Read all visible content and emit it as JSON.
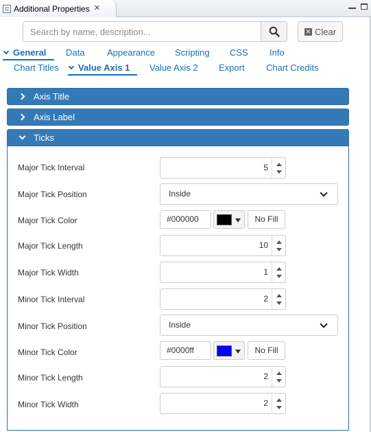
{
  "view": {
    "title": "Additional Properties",
    "close_glyph": "✕"
  },
  "search": {
    "placeholder": "Search by name, description...",
    "value": "",
    "clear_label": "Clear"
  },
  "tabs_primary": [
    {
      "label": "General",
      "active": true
    },
    {
      "label": "Data",
      "active": false
    },
    {
      "label": "Appearance",
      "active": false
    },
    {
      "label": "Scripting",
      "active": false
    },
    {
      "label": "CSS",
      "active": false
    },
    {
      "label": "Info",
      "active": false
    }
  ],
  "tabs_secondary": [
    {
      "label": "Chart Titles",
      "active": false
    },
    {
      "label": "Value Axis 1",
      "active": true
    },
    {
      "label": "Value Axis 2",
      "active": false
    },
    {
      "label": "Export",
      "active": false
    },
    {
      "label": "Chart Credits",
      "active": false
    }
  ],
  "sections": [
    {
      "title": "Axis Title",
      "expanded": false
    },
    {
      "title": "Axis Label",
      "expanded": false
    },
    {
      "title": "Ticks",
      "expanded": true
    }
  ],
  "ticks": {
    "major_interval": {
      "label": "Major Tick Interval",
      "value": "5"
    },
    "major_position": {
      "label": "Major Tick Position",
      "value": "Inside"
    },
    "major_color": {
      "label": "Major Tick Color",
      "value": "#000000",
      "swatch": "#000000",
      "nofill_label": "No Fill"
    },
    "major_length": {
      "label": "Major Tick Length",
      "value": "10"
    },
    "major_width": {
      "label": "Major Tick Width",
      "value": "1"
    },
    "minor_interval": {
      "label": "Minor Tick Interval",
      "value": "2"
    },
    "minor_position": {
      "label": "Minor Tick Position",
      "value": "Inside"
    },
    "minor_color": {
      "label": "Minor Tick Color",
      "value": "#0000ff",
      "swatch": "#0000ff",
      "nofill_label": "No Fill"
    },
    "minor_length": {
      "label": "Minor Tick Length",
      "value": "2"
    },
    "minor_width": {
      "label": "Minor Tick Width",
      "value": "2"
    }
  },
  "colors": {
    "accent": "#337ab7",
    "tab_link": "#1a6fb5"
  },
  "icons": {
    "view": "properties-view-icon",
    "close": "close-icon",
    "search": "search-icon",
    "clear": "clear-x-icon",
    "minimize": "minimize-icon",
    "maximize": "maximize-icon"
  }
}
